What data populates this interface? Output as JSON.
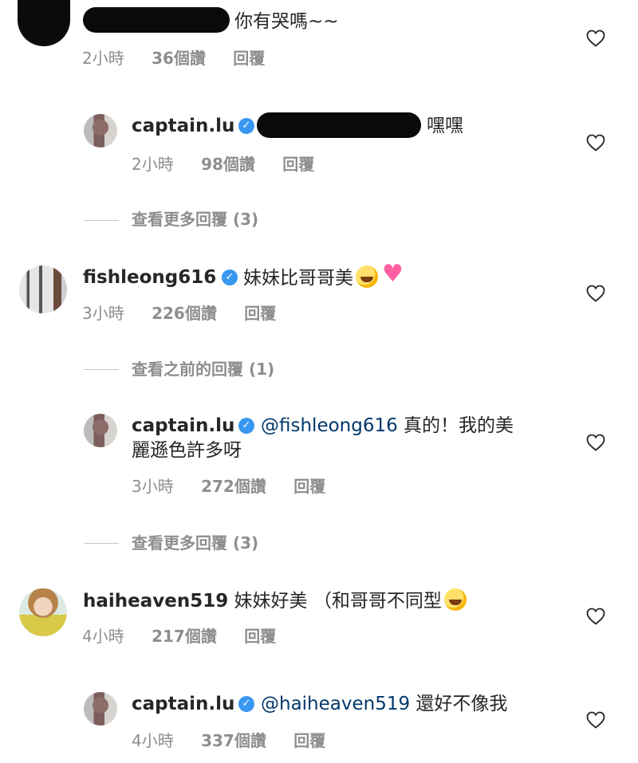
{
  "comments": [
    {
      "text": "你有哭嗎~~",
      "time": "2小時",
      "likes": "36個讚",
      "reply": "回覆"
    },
    {
      "username": "captain.lu",
      "text": "嘿嘿",
      "time": "2小時",
      "likes": "98個讚",
      "reply": "回覆"
    },
    {
      "view_replies": "查看更多回覆 (3)"
    },
    {
      "username": "fishleong616",
      "text": "妹妹比哥哥美",
      "time": "3小時",
      "likes": "226個讚",
      "reply": "回覆"
    },
    {
      "view_replies": "查看之前的回覆 (1)"
    },
    {
      "username": "captain.lu",
      "mention": "@fishleong616",
      "text_line1": " 真的！我的美",
      "text_line2": "麗遜色許多呀",
      "time": "3小時",
      "likes": "272個讚",
      "reply": "回覆"
    },
    {
      "view_replies": "查看更多回覆 (3)"
    },
    {
      "username": "haiheaven519",
      "text": " 妹妹好美 （和哥哥不同型",
      "time": "4小時",
      "likes": "217個讚",
      "reply": "回覆"
    },
    {
      "username": "captain.lu",
      "mention": "@haiheaven519",
      "text": " 還好不像我",
      "time": "4小時",
      "likes": "337個讚",
      "reply": "回覆"
    }
  ],
  "colors": {
    "verified": "#3897f0",
    "mention": "#00376b",
    "meta": "#8e8e8e"
  },
  "icons": {
    "like": "heart-outline-icon",
    "verified": "verified-badge-icon"
  }
}
